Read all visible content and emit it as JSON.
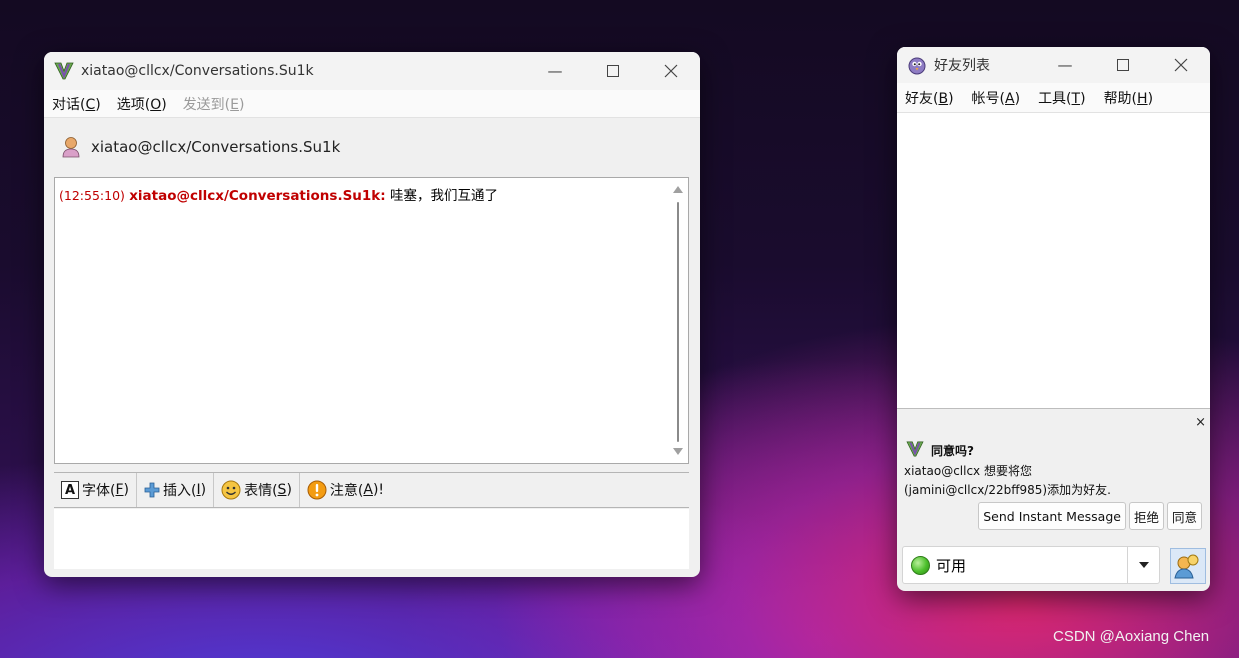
{
  "chat_window": {
    "title": "xiatao@cllcx/Conversations.Su1k",
    "menu": [
      {
        "label": "对话(",
        "key": "C",
        "suffix": ")",
        "enabled": true
      },
      {
        "label": "选项(",
        "key": "O",
        "suffix": ")",
        "enabled": true
      },
      {
        "label": "发送到(",
        "key": "E",
        "suffix": ")",
        "enabled": false
      }
    ],
    "contact_name": "xiatao@cllcx/Conversations.Su1k",
    "messages": [
      {
        "time": "(12:55:10)",
        "sender": "xiatao@cllcx/Conversations.Su1k:",
        "text": "哇塞，我们互通了"
      }
    ],
    "toolbar": {
      "font": {
        "label": "字体(",
        "key": "F",
        "suffix": ")"
      },
      "insert": {
        "label": "插入(",
        "key": "I",
        "suffix": ")"
      },
      "smiley": {
        "label": "表情(",
        "key": "S",
        "suffix": ")"
      },
      "attention": {
        "label": "注意(",
        "key": "A",
        "suffix": ")!"
      }
    }
  },
  "buddy_window": {
    "title": "好友列表",
    "menu": [
      {
        "label": "好友(",
        "key": "B",
        "suffix": ")"
      },
      {
        "label": "帐号(",
        "key": "A",
        "suffix": ")"
      },
      {
        "label": "工具(",
        "key": "T",
        "suffix": ")"
      },
      {
        "label": "帮助(",
        "key": "H",
        "suffix": ")"
      }
    ],
    "notification": {
      "title": "同意吗?",
      "line1": "xiatao@cllcx 想要将您",
      "line2": "(jamini@cllcx/22bff985)添加为好友.",
      "buttons": {
        "send_im": "Send Instant Message",
        "reject": "拒绝",
        "accept": "同意"
      }
    },
    "status": {
      "label": "可用"
    }
  },
  "watermark": "CSDN @Aoxiang Chen",
  "colors": {
    "message_header": "#c00000",
    "status_available": "#4cbf2b"
  }
}
